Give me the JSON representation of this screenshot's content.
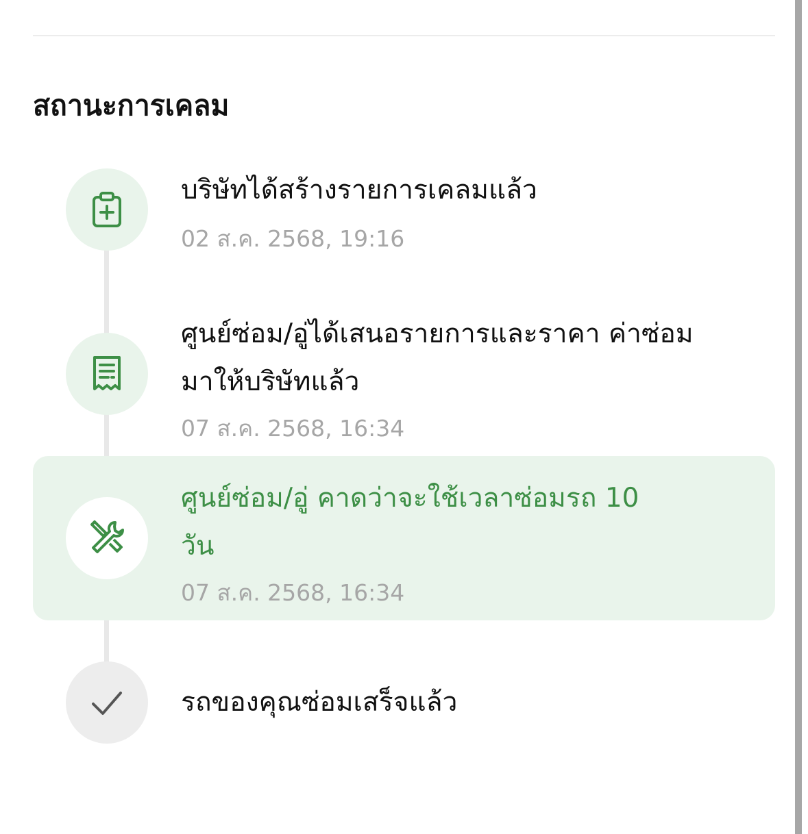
{
  "section": {
    "title": "สถานะการเคลม"
  },
  "colors": {
    "accent": "#3d8f46",
    "highlight_bg": "#e9f4eb",
    "muted_text": "#a6a6a6",
    "pending_node": "#ededed"
  },
  "steps": [
    {
      "title": "บริษัทได้สร้างรายการเคลมแล้ว",
      "time": "02 ส.ค. 2568, 19:16",
      "icon": "clipboard-plus-icon",
      "status": "done"
    },
    {
      "title": "ศูนย์ซ่อม/อู่ได้เสนอรายการและราคา ค่าซ่อม มาให้บริษัทแล้ว",
      "time": "07 ส.ค. 2568, 16:34",
      "icon": "receipt-icon",
      "status": "done"
    },
    {
      "title": "ศูนย์ซ่อม/อู่ คาดว่าจะใช้เวลาซ่อมรถ 10 วัน",
      "time": "07 ส.ค. 2568, 16:34",
      "icon": "wrench-screwdriver-icon",
      "status": "current"
    },
    {
      "title": "รถของคุณซ่อมเสร็จแล้ว",
      "icon": "checkmark-icon",
      "status": "pending"
    }
  ]
}
